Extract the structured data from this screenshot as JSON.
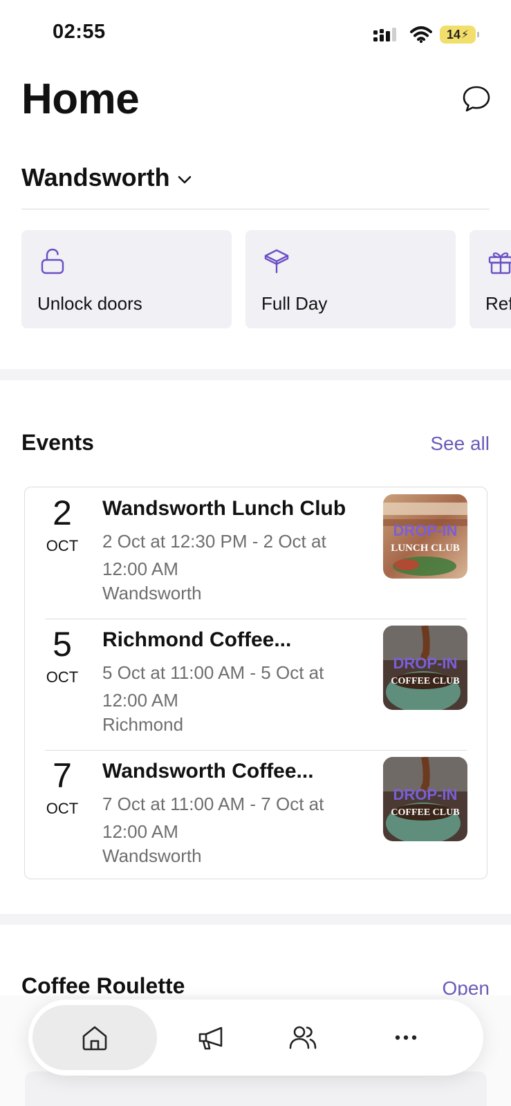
{
  "status_bar": {
    "time": "02:55",
    "battery": "14"
  },
  "header": {
    "title": "Home",
    "location": "Wandsworth"
  },
  "quick_actions": [
    {
      "label": "Unlock doors",
      "icon": "unlock-icon"
    },
    {
      "label": "Full Day",
      "icon": "box-icon"
    },
    {
      "label": "Ref",
      "icon": "gift-icon"
    }
  ],
  "events": {
    "title": "Events",
    "see_all": "See all",
    "items": [
      {
        "day": "2",
        "month": "OCT",
        "title": "Wandsworth Lunch Club",
        "time": "2 Oct at 12:30 PM - 2 Oct at 12:00 AM",
        "place": "Wandsworth",
        "thumb_line1": "DROP-IN",
        "thumb_line2": "LUNCH CLUB"
      },
      {
        "day": "5",
        "month": "OCT",
        "title": "Richmond Coffee...",
        "time": "5 Oct at 11:00 AM - 5 Oct at 12:00 AM",
        "place": "Richmond",
        "thumb_line1": "DROP-IN",
        "thumb_line2": "COFFEE CLUB"
      },
      {
        "day": "7",
        "month": "OCT",
        "title": "Wandsworth Coffee...",
        "time": "7 Oct at 11:00 AM - 7 Oct at 12:00 AM",
        "place": "Wandsworth",
        "thumb_line1": "DROP-IN",
        "thumb_line2": "COFFEE CLUB"
      }
    ]
  },
  "coffee_roulette": {
    "title": "Coffee Roulette",
    "open": "Open"
  },
  "colors": {
    "accent": "#6b5bb8",
    "card_bg": "#f0f0f5",
    "icon_purple": "#6a4fc4"
  },
  "bottom_nav": [
    {
      "name": "home",
      "icon": "home-icon",
      "active": true
    },
    {
      "name": "announcements",
      "icon": "megaphone-icon",
      "active": false
    },
    {
      "name": "people",
      "icon": "people-icon",
      "active": false
    },
    {
      "name": "more",
      "icon": "more-icon",
      "active": false
    }
  ]
}
